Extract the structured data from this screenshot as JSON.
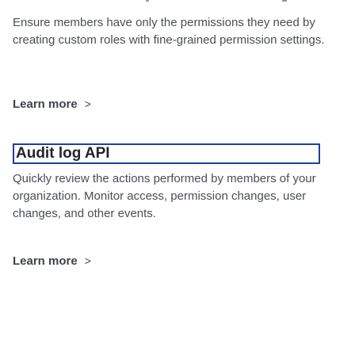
{
  "section_1": {
    "description": "Ensure members have only the permissions they need by creating custom roles with fine-grained permission settings.",
    "learn_more_label": "Learn more",
    "learn_more_chevron": ">"
  },
  "section_2": {
    "heading": "Audit log API",
    "description": "Quickly review the actions performed by members of your organization. Monitor access, permission changes, user changes, and other events.",
    "learn_more_label": "Learn more",
    "learn_more_chevron": ">"
  },
  "colors": {
    "text": "#4a4e54",
    "heading": "#232429",
    "focus_outline": "#1d3f9e",
    "background": "#ffffff"
  }
}
